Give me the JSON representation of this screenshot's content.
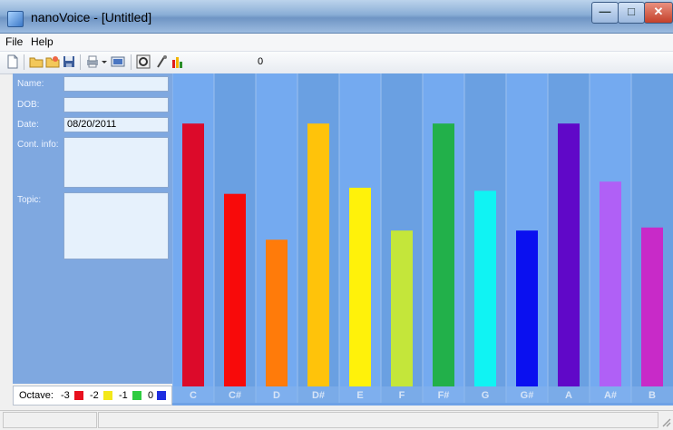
{
  "window": {
    "title": "nanoVoice - [Untitled]"
  },
  "menu": {
    "items": [
      "File",
      "Help"
    ]
  },
  "toolbar": {
    "value": "0",
    "icons": [
      "new-document-icon",
      "open-folder-icon",
      "open-recent-icon",
      "save-icon",
      "print-icon",
      "dropdown-arrow-icon",
      "display-icon",
      "settings-icon",
      "microphone-icon",
      "bar-chart-icon"
    ]
  },
  "form": {
    "name_label": "Name:",
    "dob_label": "DOB:",
    "date_label": "Date:",
    "date_value": "08/20/2011",
    "contact_label": "Cont. info:",
    "topic_label": "Topic:"
  },
  "octave": {
    "label": "Octave:",
    "items": [
      {
        "label": "-3",
        "color": "#e8101e"
      },
      {
        "label": "-2",
        "color": "#f3e81a"
      },
      {
        "label": "-1",
        "color": "#2ecc40"
      },
      {
        "label": "0",
        "color": "#1e2ee0"
      }
    ]
  },
  "chart_data": {
    "type": "bar",
    "categories": [
      "C",
      "C#",
      "D",
      "D#",
      "E",
      "F",
      "F#",
      "G",
      "G#",
      "A",
      "A#",
      "B"
    ],
    "values": [
      86,
      63,
      48,
      86,
      65,
      51,
      86,
      64,
      51,
      86,
      67,
      52
    ],
    "ylim": [
      0,
      100
    ],
    "colors": [
      "#dc0a2a",
      "#f80a0a",
      "#ff7b0a",
      "#ffc30a",
      "#fff20a",
      "#c4e63a",
      "#22b04a",
      "#10f3f3",
      "#0a10f0",
      "#6008c8",
      "#b060f6",
      "#c82ac8"
    ],
    "column_colors": [
      "#74aaf0",
      "#6aa0e2"
    ],
    "label_color": "#d6e4f7"
  }
}
